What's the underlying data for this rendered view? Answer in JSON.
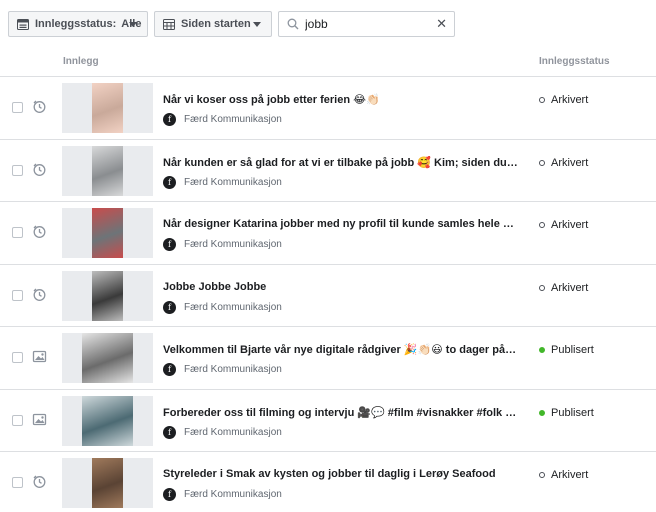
{
  "toolbar": {
    "status_filter": {
      "label": "Innleggsstatus:",
      "value": "Alle"
    },
    "date_filter": {
      "label": "Siden starten"
    },
    "search": {
      "value": "jobb",
      "clear": "✕"
    }
  },
  "table": {
    "headers": {
      "post": "Innlegg",
      "status": "Innleggsstatus"
    },
    "rows": [
      {
        "title": "Når vi koser oss på jobb etter ferien 😂👏🏻",
        "page": "Færd Kommunikasjon",
        "status": "Arkivert",
        "type": "video",
        "thumb": {
          "offset": 30,
          "width": 31,
          "color": "#c9a99a",
          "accent": "#f2d2c4"
        }
      },
      {
        "title": "Når kunden er så glad for at vi er tilbake på jobb 🥰 Kim; siden du forts...",
        "page": "Færd Kommunikasjon",
        "status": "Arkivert",
        "type": "video",
        "thumb": {
          "offset": 30,
          "width": 31,
          "color": "#8a8d90",
          "accent": "#d8d9da"
        }
      },
      {
        "title": "Når designer Katarina jobber med ny profil til kunde samles hele gjeng...",
        "page": "Færd Kommunikasjon",
        "status": "Arkivert",
        "type": "video",
        "thumb": {
          "offset": 30,
          "width": 31,
          "color": "#6d7478",
          "accent": "#c94c4c"
        }
      },
      {
        "title": "Jobbe Jobbe Jobbe",
        "page": "Færd Kommunikasjon",
        "status": "Arkivert",
        "type": "video",
        "thumb": {
          "offset": 30,
          "width": 31,
          "color": "#3a3a3a",
          "accent": "#bdbdbd"
        }
      },
      {
        "title": "Velkommen til Bjarte vår nye digitale rådgiver 🎉👏🏻😃 to dager på job...",
        "page": "Færd Kommunikasjon",
        "status": "Publisert",
        "type": "photo",
        "thumb": {
          "offset": 20,
          "width": 51,
          "color": "#6b6b6b",
          "accent": "#e6e6e6"
        }
      },
      {
        "title": "Forbereder oss til filming og intervju 🎥💬 #film #visnakker #folk #job...",
        "page": "Færd Kommunikasjon",
        "status": "Publisert",
        "type": "photo",
        "thumb": {
          "offset": 20,
          "width": 51,
          "color": "#4c6a73",
          "accent": "#cfd9dc"
        }
      },
      {
        "title": "Styreleder i Smak av kysten og jobber til daglig i Lerøy Seafood",
        "page": "Færd Kommunikasjon",
        "status": "Arkivert",
        "type": "video",
        "thumb": {
          "offset": 30,
          "width": 31,
          "color": "#5a4334",
          "accent": "#a07a5c"
        }
      }
    ]
  }
}
